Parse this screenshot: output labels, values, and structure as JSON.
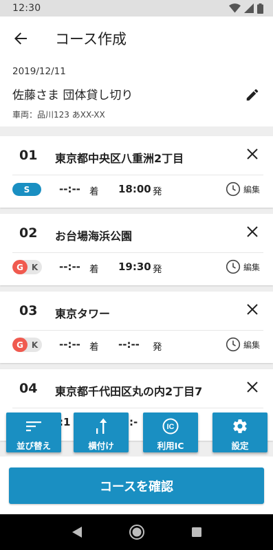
{
  "status": {
    "time": "12:30"
  },
  "appbar": {
    "title": "コース作成"
  },
  "info": {
    "date": "2019/12/11",
    "group": "佐藤さま 団体貸し切り",
    "vehicle": "車両：品川123 あXX-XX"
  },
  "stops": [
    {
      "num": "01",
      "place": "東京都中央区八重洲2丁目",
      "badge": "S",
      "arrive_time": "--:--",
      "arrive_label": "着",
      "depart_time": "18:00",
      "depart_label": "発",
      "edit_label": "編集"
    },
    {
      "num": "02",
      "place": "お台場海浜公園",
      "badge_g": "G",
      "badge_k": "K",
      "arrive_time": "--:--",
      "arrive_label": "着",
      "depart_time": "19:30",
      "depart_label": "発",
      "edit_label": "編集"
    },
    {
      "num": "03",
      "place": "東京タワー",
      "badge_g": "G",
      "badge_k": "K",
      "arrive_time": "--:--",
      "arrive_label": "着",
      "depart_time": "--:--",
      "depart_label": "発",
      "edit_label": "編集"
    },
    {
      "num": "04",
      "place": "東京都千代田区丸の内2丁目7",
      "partial_time": ":1",
      "partial_time2": ":-"
    }
  ],
  "actions": {
    "sort_label": "並び替え",
    "attach_label": "横付け",
    "ic_label": "利用IC",
    "settings_label": "設定"
  },
  "confirm_label": "コースを確認",
  "colors": {
    "primary": "#1a8fc2",
    "goal_badge": "#f05a4f"
  }
}
